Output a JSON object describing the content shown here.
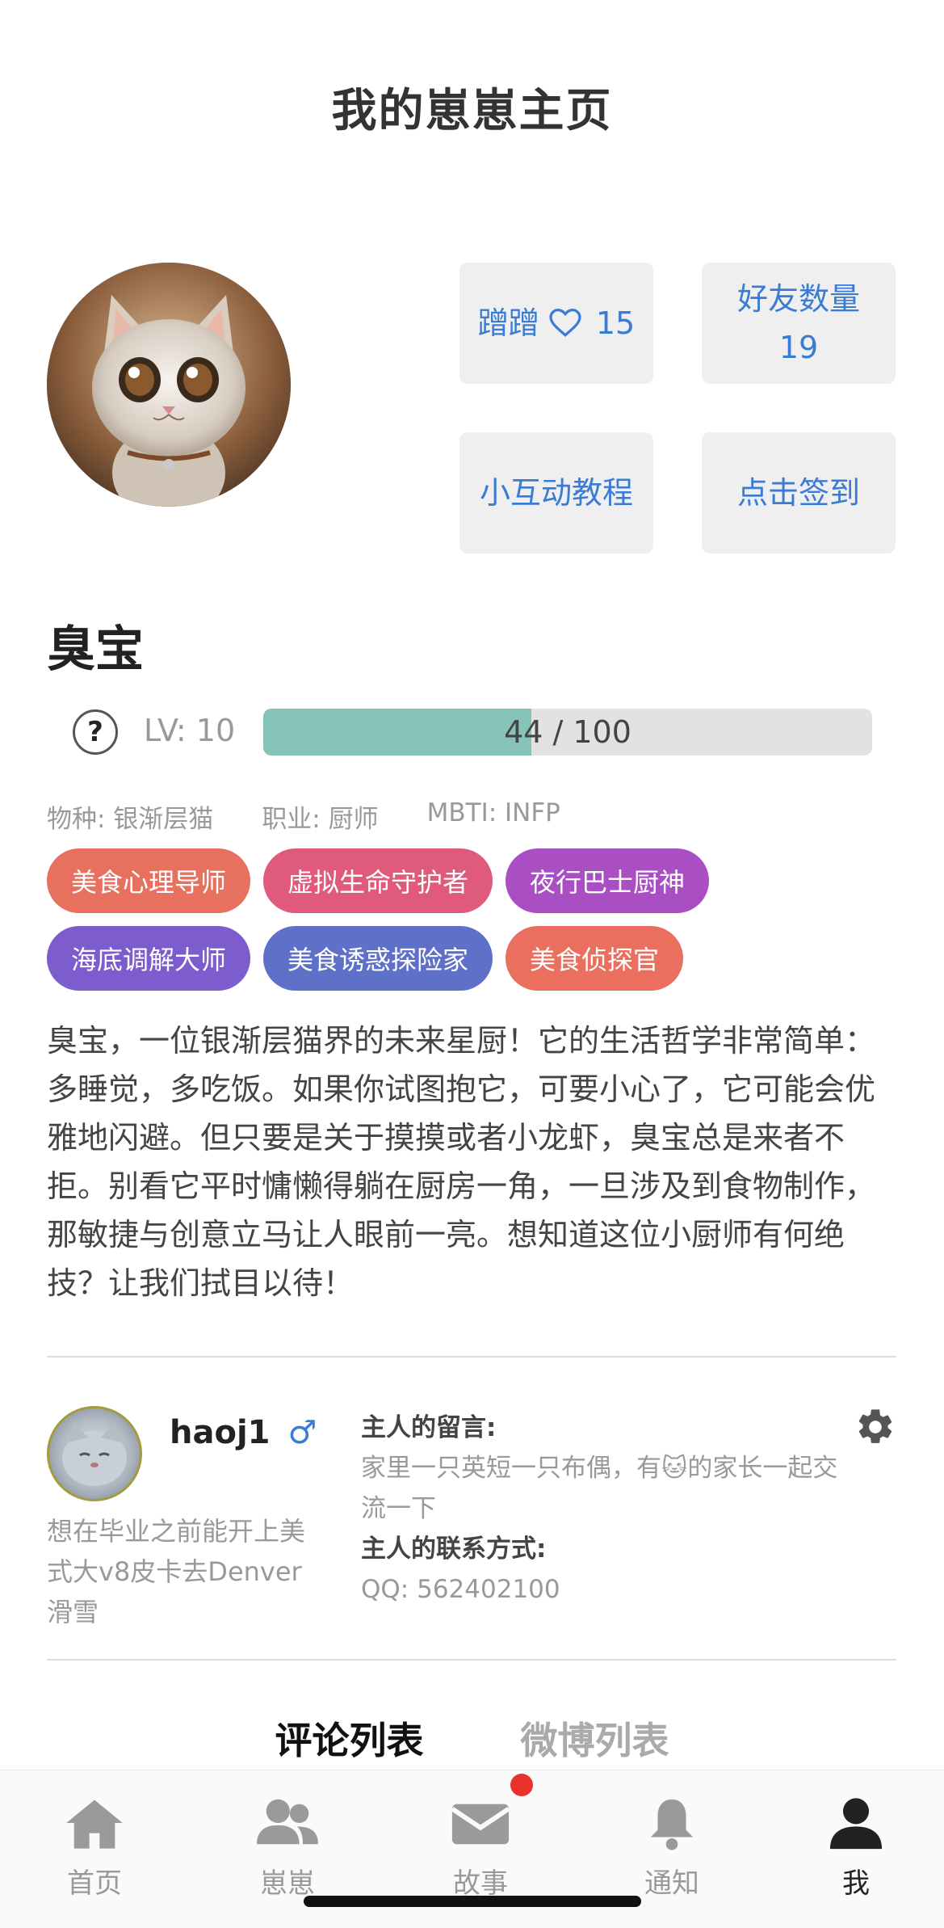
{
  "page": {
    "title": "我的崽崽主页"
  },
  "stats": {
    "likes_label": "蹭蹭",
    "likes_count": "15",
    "friends_label": "好友数量",
    "friends_count": "19",
    "tutorial_label": "小互动教程",
    "checkin_label": "点击签到"
  },
  "pet": {
    "name": "臭宝",
    "level_text": "LV: 10",
    "exp_current": 44,
    "exp_max": 100,
    "exp_text": "44 / 100",
    "species": "物种: 银渐层猫",
    "job": "职业: 厨师",
    "mbti": "MBTI: INFP",
    "tags": [
      {
        "label": "美食心理导师",
        "color": "#e8705f"
      },
      {
        "label": "虚拟生命守护者",
        "color": "#e05a7c"
      },
      {
        "label": "夜行巴士厨神",
        "color": "#a94fc3"
      },
      {
        "label": "海底调解大师",
        "color": "#7d5ccd"
      },
      {
        "label": "美食诱惑探险家",
        "color": "#5f70c8"
      },
      {
        "label": "美食侦探官",
        "color": "#ea6f5e"
      }
    ],
    "bio": "臭宝，一位银渐层猫界的未来星厨！它的生活哲学非常简单：多睡觉，多吃饭。如果你试图抱它，可要小心了，它可能会优雅地闪避。但只要是关于摸摸或者小龙虾，臭宝总是来者不拒。别看它平时慵懒得躺在厨房一角，一旦涉及到食物制作，那敏捷与创意立马让人眼前一亮。想知道这位小厨师有何绝技？让我们拭目以待！"
  },
  "owner": {
    "name": "haoj1",
    "gender_symbol": "♂",
    "bio": "想在毕业之前能开上美式大v8皮卡去Denver滑雪",
    "message_label": "主人的留言:",
    "message_before": "家里一只英短一只布偶，有",
    "message_emoji": "🐱",
    "message_after": "的家长一起交流一下",
    "contact_label": "主人的联系方式:",
    "contact_value": "QQ: 562402100"
  },
  "tabs": {
    "comments": "评论列表",
    "weibo": "微博列表"
  },
  "nav": {
    "home": "首页",
    "pets": "崽崽",
    "stories": "故事",
    "notify": "通知",
    "me": "我"
  },
  "colors": {
    "accent_blue": "#3a7bd5",
    "progress_fill": "#86c3b8",
    "badge_red": "#e8322b"
  }
}
